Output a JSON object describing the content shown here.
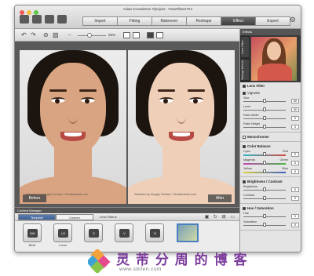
{
  "window": {
    "title": "Asian Crossdress 7/project - FaceFilter3 Pro",
    "traffic_colors": [
      "#ef5a52",
      "#f4be3a",
      "#5fc548"
    ]
  },
  "tabs": [
    {
      "label": "Import",
      "active": false
    },
    {
      "label": "Fitting",
      "active": false
    },
    {
      "label": "Makeover",
      "active": false
    },
    {
      "label": "Reshape",
      "active": false
    },
    {
      "label": "Effect",
      "active": true
    },
    {
      "label": "Export",
      "active": false
    }
  ],
  "toolbar": {
    "zoom_text": "25%"
  },
  "canvas": {
    "before_label": "Before",
    "after_label": "After",
    "credit": "Selected by Sergey Furtaev / Shutterstock.com",
    "skin_before": "#d9a481",
    "skin_after": "#f0cfb8"
  },
  "right_panel": {
    "preview_title": "Effects",
    "side_tabs": [
      "Lens Filter",
      "Vintage Effects"
    ],
    "sections": [
      {
        "title": "Lens Filter",
        "checked": true,
        "subsections": [
          {
            "title": "Vignette",
            "checked": true,
            "controls": [
              {
                "label": "Size",
                "value": "50",
                "level": 0.5
              },
              {
                "label": "Level",
                "value": "50",
                "level": 0.5
              },
              {
                "label": "Ratio Width",
                "value": "0",
                "level": 0.5
              },
              {
                "label": "Ratio Height",
                "value": "0",
                "level": 0.5
              }
            ]
          }
        ]
      },
      {
        "title": "Monochrome",
        "checked": false,
        "subsections": []
      },
      {
        "title": "Color Balance",
        "checked": true,
        "subsections": [
          {
            "title": "",
            "checked": false,
            "controls": [
              {
                "label": "Cyan",
                "sub": "Red",
                "value": "0",
                "level": 0.5,
                "colors": [
                  "#2fb7c8",
                  "#d84a44"
                ]
              },
              {
                "label": "Magenta",
                "sub": "Green",
                "value": "0",
                "level": 0.5,
                "colors": [
                  "#c04ab0",
                  "#4cb54a"
                ]
              },
              {
                "label": "Yellow",
                "sub": "Blue",
                "value": "0",
                "level": 0.5,
                "colors": [
                  "#e0cf3a",
                  "#3a5ec8"
                ]
              }
            ]
          }
        ]
      },
      {
        "title": "Brightness / Contrast",
        "checked": true,
        "subsections": [
          {
            "title": "",
            "checked": false,
            "controls": [
              {
                "label": "Brightness",
                "value": "0",
                "level": 0.5
              },
              {
                "label": "Contrast",
                "value": "0",
                "level": 0.5
              }
            ]
          }
        ]
      },
      {
        "title": "Hue / Saturation",
        "checked": true,
        "subsections": [
          {
            "title": "",
            "checked": false,
            "controls": [
              {
                "label": "Hue",
                "value": "0",
                "level": 0.5
              },
              {
                "label": "Saturation",
                "value": "0",
                "level": 0.5
              }
            ]
          }
        ]
      }
    ]
  },
  "content_manager": {
    "title": "Content Manager",
    "tabs": [
      {
        "label": "Template",
        "active": true
      },
      {
        "label": "Custom",
        "active": false
      }
    ],
    "breadcrumb": "Lens Filter ▸",
    "items": [
      {
        "label": "B&W",
        "icon_text": "BW"
      },
      {
        "label": "Lomo",
        "icon_text": "LO"
      },
      {
        "label": "",
        "icon_text": "S"
      },
      {
        "label": "",
        "icon_text": "V"
      },
      {
        "label": "",
        "icon_text": "VI"
      }
    ]
  },
  "watermark": {
    "cn_text": "灵 芾 分 周 的 博 客",
    "url": "www.sdifen.com"
  }
}
